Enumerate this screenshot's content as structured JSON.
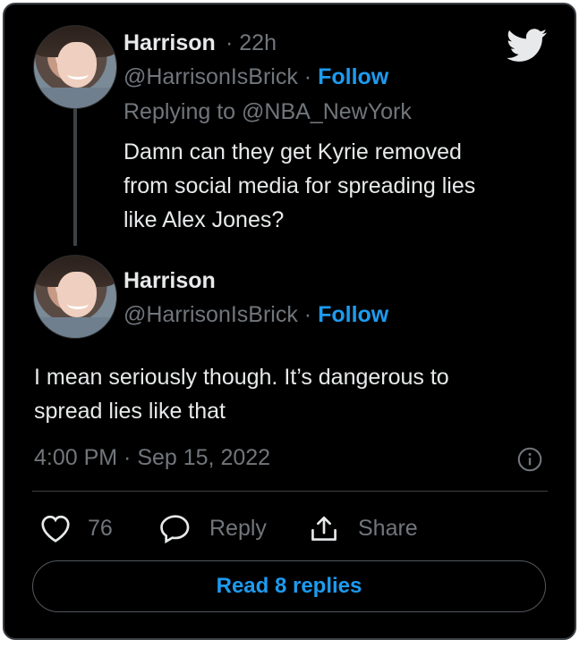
{
  "tweet1": {
    "name": "Harrison",
    "time": "22h",
    "handle": "@HarrisonIsBrick",
    "follow_label": "Follow",
    "replying_to": "Replying to @NBA_NewYork",
    "text_lines": [
      "Damn can they get Kyrie removed",
      "from social media for spreading lies",
      "like Alex Jones?"
    ]
  },
  "tweet2": {
    "name": "Harrison",
    "handle": "@HarrisonIsBrick",
    "follow_label": "Follow",
    "text_lines": [
      "I mean seriously though. It’s dangerous to",
      "spread lies like that"
    ],
    "timestamp": "4:00 PM · Sep 15, 2022"
  },
  "actions": {
    "like_count": "76",
    "reply_label": "Reply",
    "share_label": "Share"
  },
  "read_replies_label": "Read 8 replies",
  "colors": {
    "accent": "#1d9bf0",
    "background": "#000000",
    "text": "#e7e9ea",
    "muted": "#71767b"
  },
  "icons": [
    "twitter-bird-icon",
    "info-icon",
    "heart-icon",
    "reply-bubble-icon",
    "share-icon"
  ]
}
